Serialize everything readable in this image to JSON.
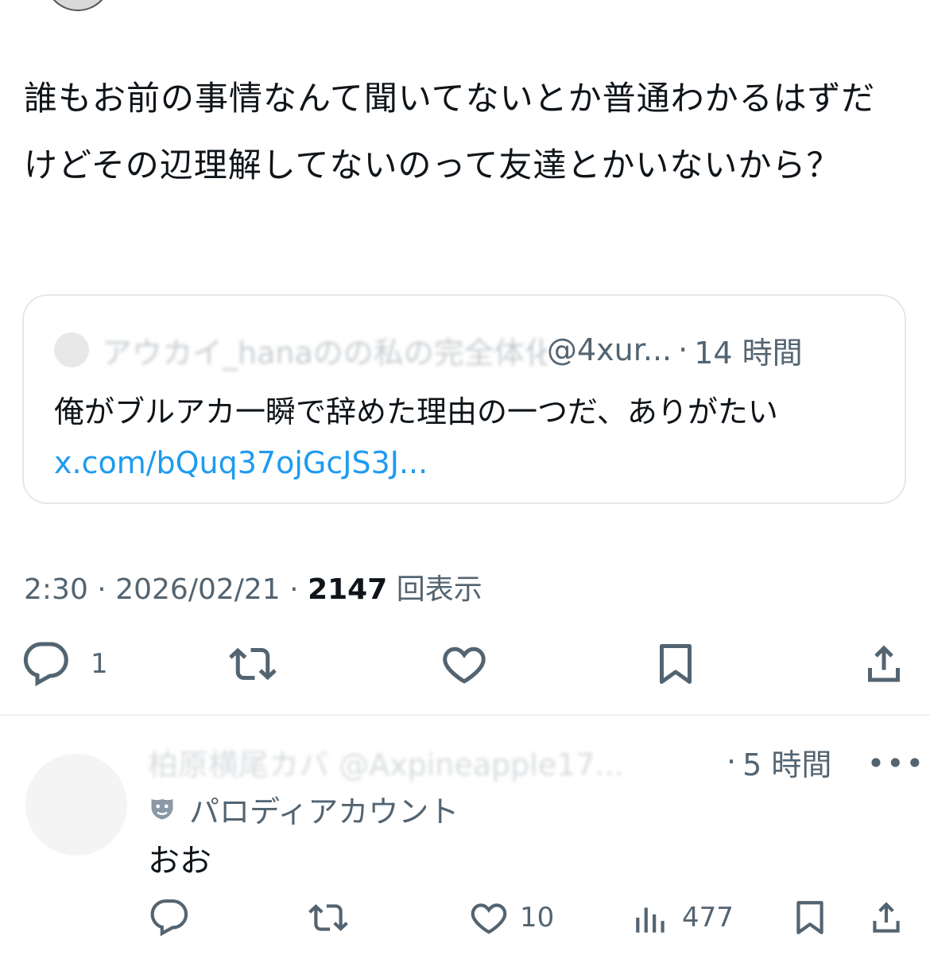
{
  "tweet": {
    "text": "誰もお前の事情なんて聞いてないとか普通わかるはずだけどその辺理解してないのって友達とかいないから？",
    "quote": {
      "display_name": "アウカイ_hanaのの私の完全体化体証",
      "handle": "@4xur...",
      "separator": "·",
      "time": "14 時間",
      "body": "俺がブルアカ一瞬で辞めた理由の一つだ、ありがたい",
      "link": "x.com/bQuq37ojGcJS3J..."
    },
    "meta": {
      "time": "2:30",
      "sep1": "·",
      "date": "2026/02/21",
      "sep2": "·",
      "views_count": "2147",
      "views_label": "回表示"
    },
    "actions": {
      "reply_count": "1"
    }
  },
  "reply": {
    "display_name": "柏原横尾カバ",
    "handle": "@Axpineapple17...",
    "separator": "·",
    "time": "5 時間",
    "more": "•••",
    "parody_label": "パロディアカウント",
    "text": "おお",
    "actions": {
      "like_count": "10",
      "views_count": "477"
    }
  },
  "colors": {
    "text": "#0f1419",
    "secondary": "#536471",
    "link": "#1d9bf0",
    "border": "#e4e8eb"
  }
}
